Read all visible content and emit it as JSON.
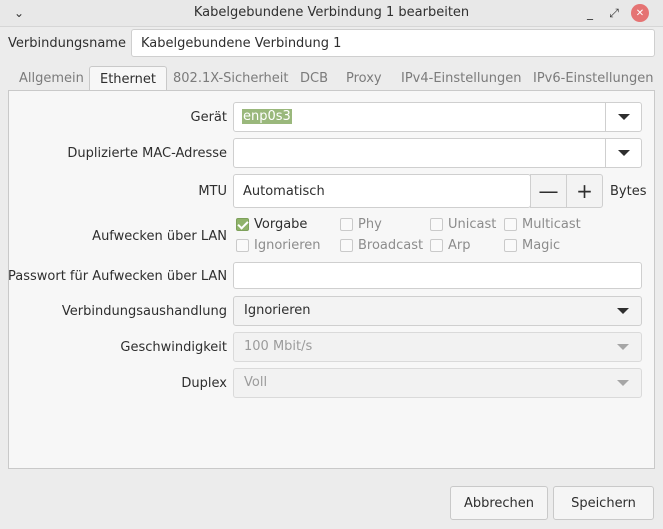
{
  "window": {
    "title": "Kabelgebundene Verbindung 1 bearbeiten",
    "menu_glyph": "⌄",
    "minimize_glyph": "_",
    "maximize_glyph": "⤢",
    "close_glyph": "✕"
  },
  "connection_name": {
    "label": "Verbindungsname",
    "value": "Kabelgebundene Verbindung 1"
  },
  "tabs": [
    {
      "label": "Allgemein",
      "active": false
    },
    {
      "label": "Ethernet",
      "active": true
    },
    {
      "label": "802.1X-Sicherheit",
      "active": false
    },
    {
      "label": "DCB",
      "active": false
    },
    {
      "label": "Proxy",
      "active": false
    },
    {
      "label": "IPv4-Einstellungen",
      "active": false
    },
    {
      "label": "IPv6-Einstellungen",
      "active": false
    }
  ],
  "ethernet": {
    "device": {
      "label": "Gerät",
      "value": "enp0s3"
    },
    "cloned_mac": {
      "label": "Duplizierte MAC-Adresse",
      "value": ""
    },
    "mtu": {
      "label": "MTU",
      "value": "Automatisch",
      "unit": "Bytes",
      "minus": "—",
      "plus": "+"
    },
    "wake_on_lan": {
      "label": "Aufwecken über LAN",
      "options": [
        {
          "label": "Vorgabe",
          "checked": true
        },
        {
          "label": "Phy",
          "checked": false
        },
        {
          "label": "Unicast",
          "checked": false
        },
        {
          "label": "Multicast",
          "checked": false
        },
        {
          "label": "Ignorieren",
          "checked": false
        },
        {
          "label": "Broadcast",
          "checked": false
        },
        {
          "label": "Arp",
          "checked": false
        },
        {
          "label": "Magic",
          "checked": false
        }
      ]
    },
    "wol_password": {
      "label": "Passwort für Aufwecken über LAN",
      "value": ""
    },
    "negotiation": {
      "label": "Verbindungsaushandlung",
      "value": "Ignorieren"
    },
    "speed": {
      "label": "Geschwindigkeit",
      "value": "100 Mbit/s"
    },
    "duplex": {
      "label": "Duplex",
      "value": "Voll"
    }
  },
  "buttons": {
    "cancel": "Abbrechen",
    "save": "Speichern"
  },
  "colors": {
    "accent": "#8fb36a",
    "selection": "#9ab87c",
    "close": "#e57373"
  }
}
